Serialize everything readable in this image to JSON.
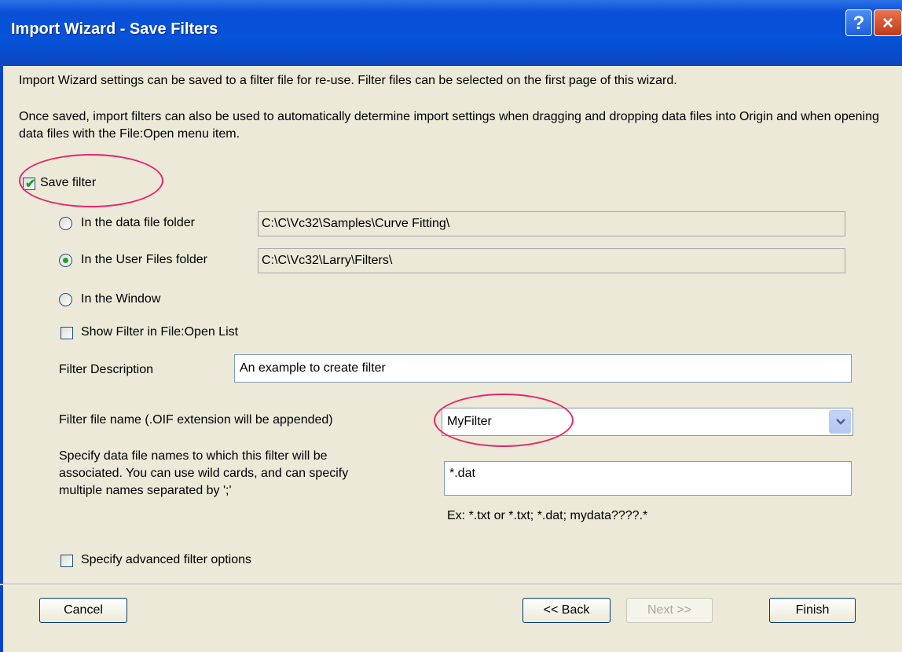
{
  "window": {
    "title": "Import Wizard - Save Filters",
    "help_glyph": "?",
    "close_glyph": "×"
  },
  "intro": {
    "line1": "Import Wizard settings can be saved to a filter file for re-use. Filter files can be selected on the first page of this wizard.",
    "line2": "Once saved, import filters can also be used to automatically determine import settings when dragging and dropping data files into Origin and when opening data files with the File:Open menu item."
  },
  "save_filter": {
    "label": "Save filter",
    "checked": true
  },
  "location": {
    "options": [
      {
        "label": "In the data file folder",
        "path": "C:\\C\\Vc32\\Samples\\Curve Fitting\\",
        "selected": false
      },
      {
        "label": "In the User Files folder",
        "path": "C:\\C\\Vc32\\Larry\\Filters\\",
        "selected": true
      },
      {
        "label": "In the Window",
        "selected": false
      }
    ]
  },
  "show_filter": {
    "label": "Show Filter in File:Open List",
    "checked": false
  },
  "description": {
    "label": "Filter Description",
    "value": "An example to create filter"
  },
  "file_name": {
    "label": "Filter file name (.OIF extension will be appended)",
    "value": "MyFilter"
  },
  "associate": {
    "label_line1": "Specify data file names to which this filter will be",
    "label_line2": "associated.  You can use wild cards, and can specify",
    "label_line3": "multiple names separated by ';'",
    "value": "*.dat",
    "example": "Ex: *.txt or *.txt; *.dat; mydata????.*"
  },
  "advanced": {
    "label": "Specify advanced filter options",
    "checked": false
  },
  "buttons": {
    "cancel": "Cancel",
    "back": "<< Back",
    "next": "Next >>",
    "finish": "Finish"
  },
  "colors": {
    "title_bar": "#0552d8",
    "highlight_ring": "#e8246c",
    "check_green": "#21a121"
  }
}
